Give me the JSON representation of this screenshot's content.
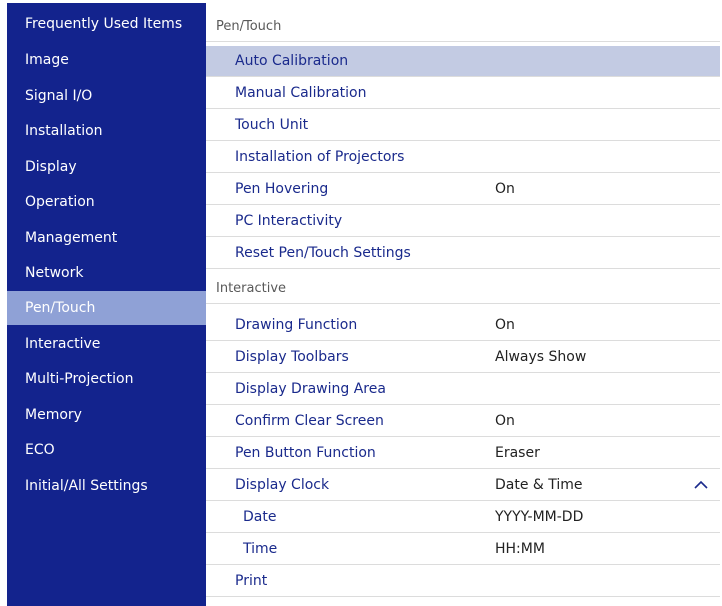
{
  "sidebar": {
    "items": [
      {
        "label": "Frequently Used Items"
      },
      {
        "label": "Image"
      },
      {
        "label": "Signal I/O"
      },
      {
        "label": "Installation"
      },
      {
        "label": "Display"
      },
      {
        "label": "Operation"
      },
      {
        "label": "Management"
      },
      {
        "label": "Network"
      },
      {
        "label": "Pen/Touch",
        "active": true
      },
      {
        "label": "Interactive"
      },
      {
        "label": "Multi-Projection"
      },
      {
        "label": "Memory"
      },
      {
        "label": "ECO"
      },
      {
        "label": "Initial/All Settings"
      }
    ]
  },
  "main": {
    "sections": [
      {
        "title": "Pen/Touch",
        "rows": [
          {
            "label": "Auto Calibration",
            "value": "",
            "selected": true
          },
          {
            "label": "Manual Calibration",
            "value": ""
          },
          {
            "label": "Touch Unit",
            "value": ""
          },
          {
            "label": "Installation of Projectors",
            "value": ""
          },
          {
            "label": "Pen Hovering",
            "value": "On"
          },
          {
            "label": "PC Interactivity",
            "value": ""
          },
          {
            "label": "Reset Pen/Touch Settings",
            "value": ""
          }
        ]
      },
      {
        "title": "Interactive",
        "rows": [
          {
            "label": "Drawing Function",
            "value": "On"
          },
          {
            "label": "Display Toolbars",
            "value": "Always Show"
          },
          {
            "label": "Display Drawing Area",
            "value": ""
          },
          {
            "label": "Confirm Clear Screen",
            "value": "On"
          },
          {
            "label": "Pen Button Function",
            "value": "Eraser"
          },
          {
            "label": "Display Clock",
            "value": "Date & Time",
            "expanded": true,
            "icon": "chevron-up-icon"
          },
          {
            "label": "Date",
            "value": "YYYY-MM-DD",
            "sub": true
          },
          {
            "label": "Time",
            "value": "HH:MM",
            "sub": true
          },
          {
            "label": "Print",
            "value": ""
          }
        ]
      }
    ]
  },
  "colors": {
    "sidebar_bg": "#13238d",
    "sidebar_active": "#8fa1d6",
    "row_selected": "#c3cbe3",
    "label_text": "#1a2a8c"
  }
}
